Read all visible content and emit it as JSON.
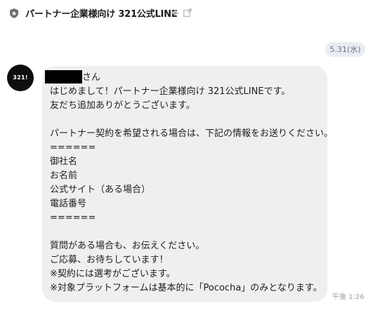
{
  "header": {
    "title": "パートナー企業様向け 321公式LINE",
    "shield_icon": "shield-icon",
    "mute_icon": "speaker-mute-icon",
    "popout_icon": "popout-window-icon"
  },
  "date_chip": "5.31(水)",
  "avatar": {
    "text": "321!"
  },
  "message": {
    "lines": [
      "さん",
      "はじめまして！パートナー企業様向け 321公式LINEです。",
      "友だち追加ありがとうございます。",
      "",
      "パートナー契約を希望される場合は、下記の情報をお送りください。",
      "======",
      "御社名",
      "お名前",
      "公式サイト（ある場合）",
      "電話番号",
      "======",
      "",
      "質問がある場合も、お伝えください。",
      "ご応募、お待ちしています！",
      "※契約には選考がございます。",
      "※対象プラットフォームは基本的に「Pococha」のみとなります。"
    ],
    "time": "午後 1:26"
  }
}
